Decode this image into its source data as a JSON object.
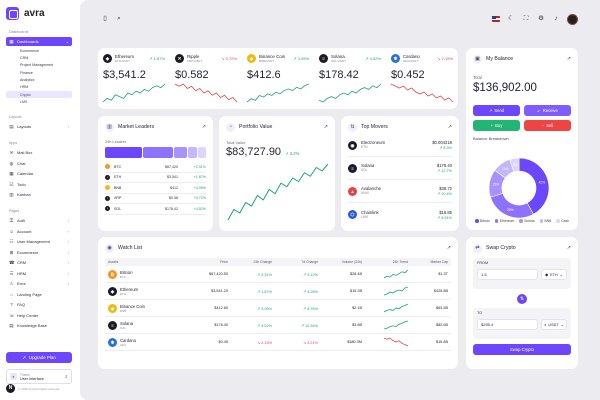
{
  "app": {
    "name": "avra"
  },
  "sidebar": {
    "section_dashboards": "Dashboards",
    "dashboards_label": "Dashboards",
    "dashboard_subitems": [
      "Ecommerce",
      "CRM",
      "Project Management",
      "Finance",
      "Analytics",
      "HRM",
      "Crypto",
      "LMS"
    ],
    "selected_subitem": "Crypto",
    "section_layouts": "Layouts",
    "layouts_label": "Layouts",
    "section_apps": "Apps",
    "apps": [
      "Mail Box",
      "Chat",
      "Calendar",
      "Todo",
      "Kanban"
    ],
    "section_pages": "Pages",
    "pages": [
      "Auth",
      "Account",
      "User Management",
      "Ecommerce",
      "CRM",
      "HRM",
      "Error",
      "Landing Page",
      "FAQ",
      "Help Center",
      "Knowledge Base"
    ],
    "upgrade_label": "Upgrade Plan",
    "theme_label": "Theme",
    "theme_value": "User Interface",
    "copyright": "© 2025 Avra All rights reserved.",
    "badge": "N"
  },
  "topbar": {
    "icons": [
      "sidebar-toggle-icon",
      "search-icon",
      "flag-icon",
      "moon-icon",
      "fullscreen-icon",
      "settings-icon",
      "bell-icon",
      "avatar"
    ]
  },
  "tickers": [
    {
      "name": "Ethereum",
      "pair": "ETH/USDT",
      "change": "1.87%",
      "dir": "up",
      "price": "$3,541.2",
      "color": "#1c1c28",
      "glyph": "◆",
      "spark": [
        9,
        11,
        10,
        13,
        12,
        11,
        14,
        13,
        15,
        14,
        16,
        15,
        17,
        18,
        17,
        19
      ]
    },
    {
      "name": "Ripple",
      "pair": "XRP/USDT",
      "change": "0.72%",
      "dir": "down",
      "price": "$0.582",
      "color": "#1c1c28",
      "glyph": "✕",
      "spark": [
        17,
        16,
        17,
        15,
        16,
        14,
        15,
        13,
        14,
        12,
        13,
        11,
        12,
        10,
        11,
        9
      ]
    },
    {
      "name": "Binance Coin",
      "pair": "BNB/USDT",
      "change": "3.05%",
      "dir": "up",
      "price": "$412.6",
      "color": "#f0b90b",
      "glyph": "◈",
      "spark": [
        8,
        10,
        9,
        12,
        11,
        13,
        12,
        14,
        13,
        15,
        16,
        15,
        17,
        16,
        18,
        19
      ]
    },
    {
      "name": "Solana",
      "pair": "SOL/USDT",
      "change": "4.52%",
      "dir": "up",
      "price": "$178.42",
      "color": "#1c1c28",
      "glyph": "≡",
      "spark": [
        10,
        9,
        11,
        12,
        11,
        13,
        14,
        13,
        15,
        14,
        16,
        17,
        16,
        18,
        17,
        19
      ]
    },
    {
      "name": "Cardano",
      "pair": "ADA/USDT",
      "change": "2.15%",
      "dir": "down",
      "price": "$0.452",
      "color": "#2a6fdb",
      "glyph": "✱",
      "spark": [
        18,
        17,
        16,
        17,
        15,
        16,
        14,
        13,
        14,
        12,
        13,
        11,
        12,
        10,
        11,
        9
      ]
    }
  ],
  "balance": {
    "title": "My Balance",
    "total_label": "Total",
    "total": "$136,902.00",
    "buttons": [
      {
        "label": "Send",
        "color": "#6c47ff",
        "glyph": "↗"
      },
      {
        "label": "Receive",
        "color": "#7f5cff",
        "glyph": "↙"
      },
      {
        "label": "Buy",
        "color": "#22b573",
        "glyph": "+"
      },
      {
        "label": "Sell",
        "color": "#ef4444",
        "glyph": "−"
      }
    ],
    "breakdown_label": "Balance Breakdown",
    "breakdown": [
      {
        "name": "Bitcoin",
        "value": 42,
        "label": "42%",
        "color": "#6c47ff"
      },
      {
        "name": "Ethereum",
        "value": 28,
        "label": "28%",
        "color": "#8e72ff"
      },
      {
        "name": "Solana",
        "value": 15,
        "label": "15%",
        "color": "#a892ff"
      },
      {
        "name": "BNB",
        "value": 10,
        "label": "10%",
        "color": "#c4b6ff"
      },
      {
        "name": "Cash",
        "value": 5,
        "label": "5%",
        "color": "#ddd5ff"
      }
    ]
  },
  "leaders": {
    "title": "Market Leaders",
    "subtitle": "24h Leaders",
    "bar": [
      {
        "value": 33,
        "color": "#6c47ff"
      },
      {
        "value": 27,
        "color": "#8e72ff"
      },
      {
        "value": 12,
        "color": "#a892ff"
      },
      {
        "value": 8,
        "color": "#c4b6ff"
      },
      {
        "value": 7,
        "color": "#ddd5ff"
      }
    ],
    "rows": [
      {
        "sym": "BTC",
        "price": "$67,420",
        "change": "+2.31%",
        "color": "#f7931a"
      },
      {
        "sym": "ETH",
        "price": "$3,541",
        "change": "+1.87%",
        "color": "#1c1c28"
      },
      {
        "sym": "BNB",
        "price": "$412",
        "change": "+3.05%",
        "color": "#f0b90b"
      },
      {
        "sym": "XRP",
        "price": "$0.58",
        "change": "+0.72%",
        "color": "#1c1c28"
      },
      {
        "sym": "SOL",
        "price": "$178.42",
        "change": "+4.52%",
        "color": "#1c1c28"
      }
    ]
  },
  "portfolio": {
    "title": "Portfolio Value",
    "total_label": "Total Value",
    "total": "$83,727.90",
    "change": "3.2%",
    "series": [
      10,
      22,
      18,
      30,
      26,
      38,
      33,
      45,
      40,
      52,
      48,
      58,
      54,
      64,
      60,
      70,
      66,
      74
    ]
  },
  "movers": {
    "title": "Top Movers",
    "rows": [
      {
        "name": "Electroneum",
        "sym": "ETN",
        "price": "$0.004218",
        "change": "8.3%",
        "color": "#1c1c28",
        "glyph": "◉"
      },
      {
        "name": "Solana",
        "sym": "SOL",
        "price": "$178.40",
        "change": "12.7%",
        "color": "#1c1c28",
        "glyph": "≡"
      },
      {
        "name": "Avalanche",
        "sym": "AVAX",
        "price": "$38.72",
        "change": "10.4%",
        "color": "#e84142",
        "glyph": "▲"
      },
      {
        "name": "Chainlink",
        "sym": "LINK",
        "price": "$16.85",
        "change": "8.91%",
        "color": "#2a5ada",
        "glyph": "⬡"
      }
    ]
  },
  "watchlist": {
    "title": "Watch List",
    "headers": [
      "Assets",
      "Price",
      "24h Change",
      "7d Change",
      "Volume (24h)",
      "24h Trend",
      "Market Cap"
    ],
    "rows": [
      {
        "name": "Bitcoin",
        "sym": "BTC",
        "price": "$67,420.50",
        "c24": "2.31%",
        "c24dir": "up",
        "c7": "5.12%",
        "c7dir": "up",
        "vol": "$28.4B",
        "mc": "$1.3T",
        "color": "#f7931a",
        "glyph": "₿",
        "trend": [
          4,
          6,
          5,
          8,
          7,
          9,
          11,
          10,
          13
        ]
      },
      {
        "name": "Ethereum",
        "sym": "ETH",
        "price": "$3,541.20",
        "c24": "1.87%",
        "c24dir": "up",
        "c7": "4.28%",
        "c7dir": "up",
        "vol": "$15.2B",
        "mc": "$425.8B",
        "color": "#1c1c28",
        "glyph": "◆",
        "trend": [
          4,
          5,
          7,
          6,
          8,
          9,
          8,
          11,
          12
        ]
      },
      {
        "name": "Binance Coin",
        "sym": "BNB",
        "price": "$412.60",
        "c24": "3.05%",
        "c24dir": "up",
        "c7": "8.76%",
        "c7dir": "up",
        "vol": "$2.1B",
        "mc": "$63.5B",
        "color": "#f0b90b",
        "glyph": "◈",
        "trend": [
          3,
          5,
          6,
          5,
          8,
          7,
          10,
          11,
          13
        ]
      },
      {
        "name": "Solana",
        "sym": "SOL",
        "price": "$178.40",
        "c24": "4.52%",
        "c24dir": "up",
        "c7": "12.34%",
        "c7dir": "up",
        "vol": "$3.8B",
        "mc": "$82.6B",
        "color": "#1c1c28",
        "glyph": "≡",
        "trend": [
          3,
          4,
          6,
          7,
          6,
          9,
          10,
          12,
          13
        ]
      },
      {
        "name": "Cardano",
        "sym": "ADA",
        "price": "$0.45",
        "c24": "2.15%",
        "c24dir": "down",
        "c7": "3.21%",
        "c7dir": "down",
        "vol": "$380.0M",
        "mc": "$15.8B",
        "color": "#2a6fdb",
        "glyph": "✱",
        "trend": [
          12,
          11,
          12,
          10,
          9,
          10,
          8,
          7,
          6
        ]
      }
    ]
  },
  "swap": {
    "title": "Swap Crypto",
    "from_label": "FROM",
    "from_value": "1.5",
    "from_coin": "ETH",
    "to_label": "TO",
    "to_value": "$295.4",
    "to_coin": "USDT",
    "button": "Swap Crypto"
  }
}
